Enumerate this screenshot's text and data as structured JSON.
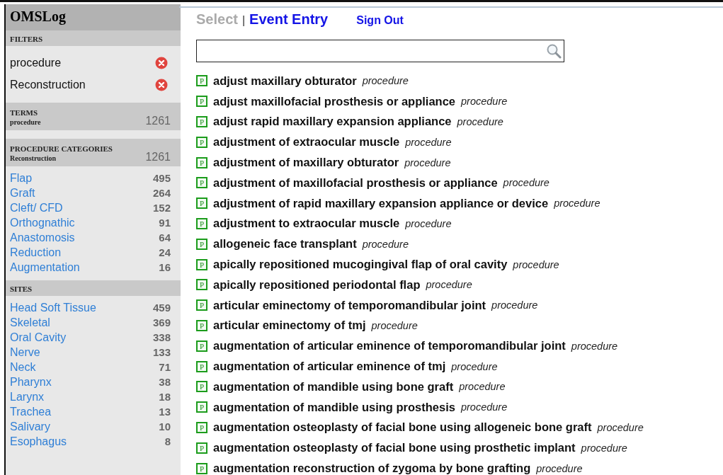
{
  "app_title": "OMSLog",
  "filters": {
    "heading": "FILTERS",
    "items": [
      {
        "label": "procedure"
      },
      {
        "label": "Reconstruction"
      }
    ]
  },
  "terms": {
    "heading": "TERMS",
    "subheading": "procedure",
    "count": "1261"
  },
  "procedure_categories": {
    "heading": "PROCEDURE CATEGORIES",
    "subheading": "Reconstruction",
    "count": "1261",
    "items": [
      {
        "label": "Flap",
        "count": "495"
      },
      {
        "label": "Graft",
        "count": "264"
      },
      {
        "label": "Cleft/ CFD",
        "count": "152"
      },
      {
        "label": "Orthognathic",
        "count": "91"
      },
      {
        "label": "Anastomosis",
        "count": "64"
      },
      {
        "label": "Reduction",
        "count": "24"
      },
      {
        "label": "Augmentation",
        "count": "16"
      }
    ]
  },
  "sites": {
    "heading": "SITES",
    "items": [
      {
        "label": "Head Soft Tissue",
        "count": "459"
      },
      {
        "label": "Skeletal",
        "count": "369"
      },
      {
        "label": "Oral Cavity",
        "count": "338"
      },
      {
        "label": "Nerve",
        "count": "133"
      },
      {
        "label": "Neck",
        "count": "71"
      },
      {
        "label": "Pharynx",
        "count": "38"
      },
      {
        "label": "Larynx",
        "count": "18"
      },
      {
        "label": "Trachea",
        "count": "13"
      },
      {
        "label": "Salivary",
        "count": "10"
      },
      {
        "label": "Esophagus",
        "count": "8"
      }
    ]
  },
  "tabs": [
    {
      "label": "Select",
      "selected": false
    },
    {
      "label": "Event Entry",
      "selected": true
    }
  ],
  "tab_separator": "|",
  "sign_out": "Sign Out",
  "results": [
    {
      "badge": "P",
      "term": "adjust maxillary obturator",
      "type": "procedure"
    },
    {
      "badge": "P",
      "term": "adjust maxillofacial prosthesis or appliance",
      "type": "procedure"
    },
    {
      "badge": "P",
      "term": "adjust rapid maxillary expansion appliance",
      "type": "procedure"
    },
    {
      "badge": "P",
      "term": "adjustment of extraocular muscle",
      "type": "procedure"
    },
    {
      "badge": "P",
      "term": "adjustment of maxillary obturator",
      "type": "procedure"
    },
    {
      "badge": "P",
      "term": "adjustment of maxillofacial prosthesis or appliance",
      "type": "procedure"
    },
    {
      "badge": "P",
      "term": "adjustment of rapid maxillary expansion appliance or device",
      "type": "procedure"
    },
    {
      "badge": "P",
      "term": "adjustment to extraocular muscle",
      "type": "procedure"
    },
    {
      "badge": "P",
      "term": "allogeneic face transplant",
      "type": "procedure"
    },
    {
      "badge": "P",
      "term": "apically repositioned mucogingival flap of oral cavity",
      "type": "procedure"
    },
    {
      "badge": "P",
      "term": "apically repositioned periodontal flap",
      "type": "procedure"
    },
    {
      "badge": "P",
      "term": "articular eminectomy of temporomandibular joint",
      "type": "procedure"
    },
    {
      "badge": "P",
      "term": "articular eminectomy of tmj",
      "type": "procedure"
    },
    {
      "badge": "P",
      "term": "augmentation of articular eminence of temporomandibular joint",
      "type": "procedure"
    },
    {
      "badge": "P",
      "term": "augmentation of articular eminence of tmj",
      "type": "procedure"
    },
    {
      "badge": "P",
      "term": "augmentation of mandible using bone graft",
      "type": "procedure"
    },
    {
      "badge": "P",
      "term": "augmentation of mandible using prosthesis",
      "type": "procedure"
    },
    {
      "badge": "P",
      "term": "augmentation osteoplasty of facial bone using allogeneic bone graft",
      "type": "procedure"
    },
    {
      "badge": "P",
      "term": "augmentation osteoplasty of facial bone using prosthetic implant",
      "type": "procedure"
    },
    {
      "badge": "P",
      "term": "augmentation reconstruction of zygoma by bone grafting",
      "type": "procedure"
    }
  ]
}
